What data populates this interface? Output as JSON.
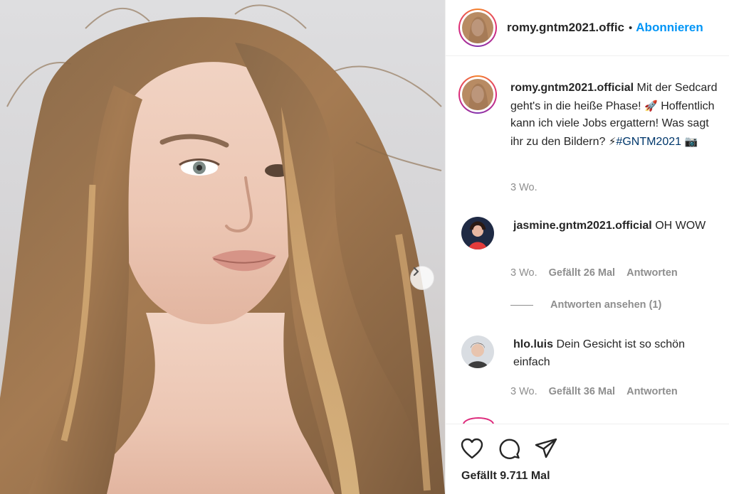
{
  "post": {
    "author": "romy.gntm2021.offic",
    "author_full": "romy.gntm2021.official",
    "separator": "•",
    "follow_label": "Abonnieren",
    "caption": "Mit der Sedcard geht's in die heiße Phase!",
    "caption_rest": "Hoffentlich kann ich viele Jobs ergattern! Was sagt ihr zu den Bildern?",
    "caption_emoji_rocket": "🚀",
    "caption_emoji_bolt": "⚡",
    "hashtag": "#GNTM2021",
    "caption_emoji_camera": "📷",
    "time": "3 Wo.",
    "likes": "Gefällt 9.711 Mal"
  },
  "comments": [
    {
      "user": "jasmine.gntm2021.official",
      "text": "OH WOW",
      "time": "3 Wo.",
      "likes": "Gefällt 26 Mal",
      "reply": "Antworten",
      "view_replies": "Antworten ansehen (1)"
    },
    {
      "user": "hlo.luis",
      "text": "Dein Gesicht ist so schön einfach",
      "time": "3 Wo.",
      "likes": "Gefällt 36 Mal",
      "reply": "Antworten"
    }
  ],
  "colors": {
    "accent": "#0095f6",
    "hashtag": "#00376b",
    "muted": "#8e8e8e",
    "text": "#262626"
  },
  "icons": [
    "chevron-right-icon",
    "heart-icon",
    "comment-icon",
    "share-icon"
  ]
}
